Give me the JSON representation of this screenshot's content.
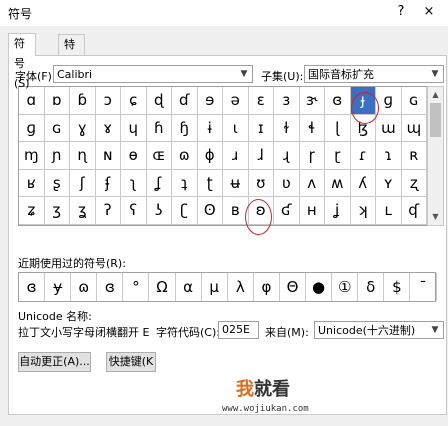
{
  "window": {
    "title": "符号",
    "help": "?",
    "close": "×"
  },
  "tabs": [
    {
      "label": "符号(S)"
    },
    {
      "label": "特殊字符(P)"
    }
  ],
  "font": {
    "label": "字体(F):",
    "value": "Calibri"
  },
  "subset": {
    "label": "子集(U):",
    "value": "国际音标扩充"
  },
  "grid": {
    "rows": [
      [
        "ɑ",
        "ɒ",
        "ɓ",
        "ɔ",
        "ɕ",
        "ɖ",
        "ɗ",
        "ɘ",
        "ə",
        "ɛ",
        "ɜ",
        "ɝ",
        "ɞ",
        "ɟ",
        "ɡ",
        "ɢ"
      ],
      [
        "ɡ",
        "ɢ",
        "ɣ",
        "ɤ",
        "ɥ",
        "ɦ",
        "ɧ",
        "ɨ",
        "ɩ",
        "ɪ",
        "ɫ",
        "ɬ",
        "ɭ",
        "ɮ",
        "ɯ",
        "ɰ"
      ],
      [
        "ɱ",
        "ɲ",
        "ɳ",
        "ɴ",
        "ɵ",
        "ɶ",
        "ɷ",
        "ɸ",
        "ɹ",
        "ɺ",
        "ɻ",
        "ɼ",
        "ɽ",
        "ɾ",
        "ɿ",
        "ʀ"
      ],
      [
        "ʁ",
        "ʂ",
        "ʃ",
        "ʄ",
        "ʅ",
        "ʆ",
        "ʇ",
        "ʈ",
        "ʉ",
        "ʊ",
        "ʋ",
        "ʌ",
        "ʍ",
        "ʎ",
        "ʏ",
        "ʐ"
      ],
      [
        "ʑ",
        "ʒ",
        "ʓ",
        "ʔ",
        "ʕ",
        "ʖ",
        "ʗ",
        "ʘ",
        "ʙ",
        "ʚ",
        "ʛ",
        "ʜ",
        "ʝ",
        "ʞ",
        "ʟ",
        "ʠ"
      ]
    ],
    "selected": "ɞ"
  },
  "recent": {
    "label": "近期使用过的符号(R):",
    "symbols": [
      "ɞ",
      "ɏ",
      "ɷ",
      "ɞ",
      "°",
      "Ω",
      "α",
      "μ",
      "λ",
      "φ",
      "Θ",
      "●",
      "①",
      "δ",
      "$",
      "ˉ"
    ]
  },
  "unicode": {
    "name_label": "Unicode 名称:",
    "name_value": "拉丁文小写字母闭横翻开 E"
  },
  "charcode": {
    "label": "字符代码(C):",
    "value": "025E"
  },
  "from": {
    "label": "来自(M):",
    "value": "Unicode(十六进制)"
  },
  "buttons": {
    "autocorrect": "自动更正(A)...",
    "shortcut": "快捷键(K"
  },
  "watermark": {
    "main_prefix": "我",
    "main_rest": "就看",
    "url": "www.wojiukan.com"
  },
  "colors": {
    "selection": "#3a6fc4",
    "annotation": "#d42020"
  }
}
